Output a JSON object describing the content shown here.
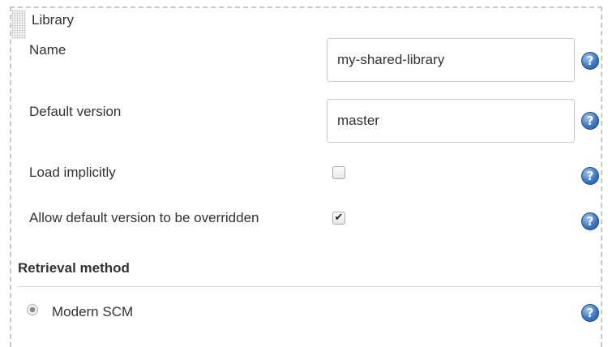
{
  "library": {
    "title": "Library",
    "name_label": "Name",
    "name_value": "my-shared-library",
    "default_version_label": "Default version",
    "default_version_value": "master",
    "load_implicitly_label": "Load implicitly",
    "load_implicitly_checked": false,
    "allow_override_label": "Allow default version to be overridden",
    "allow_override_checked": true,
    "help_glyph": "?"
  },
  "retrieval": {
    "title": "Retrieval method",
    "options": [
      {
        "label": "Modern SCM",
        "selected": true
      }
    ]
  },
  "icons": {
    "help": "help-icon",
    "grip": "drag-grip-icon",
    "check": "✔"
  },
  "colors": {
    "help_icon": "#3d79c9",
    "border": "#c8c8c8",
    "text": "#333333"
  }
}
